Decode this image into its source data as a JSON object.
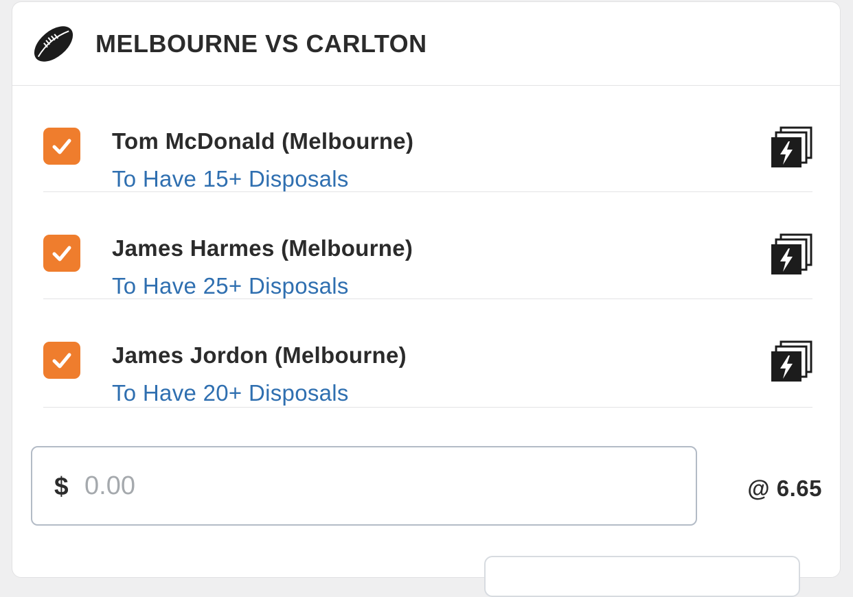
{
  "header": {
    "icon": "football-icon",
    "title": "MELBOURNE VS CARLTON"
  },
  "legs": [
    {
      "player": "Tom McDonald (Melbourne)",
      "market": "To Have 15+ Disposals",
      "checked": true
    },
    {
      "player": "James Harmes (Melbourne)",
      "market": "To Have 25+ Disposals",
      "checked": true
    },
    {
      "player": "James Jordon (Melbourne)",
      "market": "To Have 20+ Disposals",
      "checked": true
    }
  ],
  "stake": {
    "currency": "$",
    "placeholder": "0.00",
    "value": ""
  },
  "odds": "@ 6.65",
  "colors": {
    "checkbox": "#ef7d2d",
    "market_text": "#2f6fb0",
    "title_text": "#2b2b2b"
  }
}
